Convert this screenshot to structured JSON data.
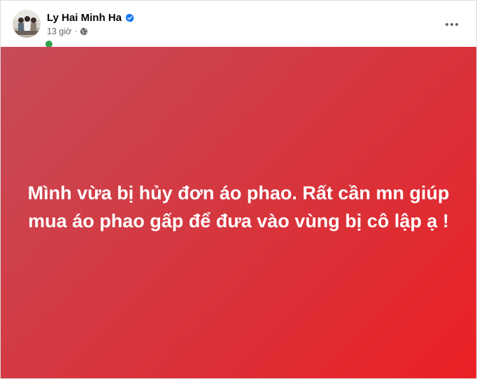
{
  "post": {
    "author": {
      "name": "Ly Hai Minh Ha",
      "verified": true,
      "online": true
    },
    "timestamp": "13 giờ",
    "separator": "·",
    "privacy": "public-globe-icon",
    "more_menu_icon": "more-horizontal-icon",
    "message": "Mình vừa bị hủy đơn áo phao. Rất cần mn giúp mua áo phao gấp để đưa vào vùng bị cô lập ạ !",
    "background": {
      "gradient_start": "#c64c58",
      "gradient_end": "#eb2026",
      "text_color": "#ffffff"
    }
  },
  "colors": {
    "verified_badge": "#1877f2",
    "online_status": "#31a24c",
    "secondary_text": "#65676b",
    "primary_text": "#050505"
  }
}
